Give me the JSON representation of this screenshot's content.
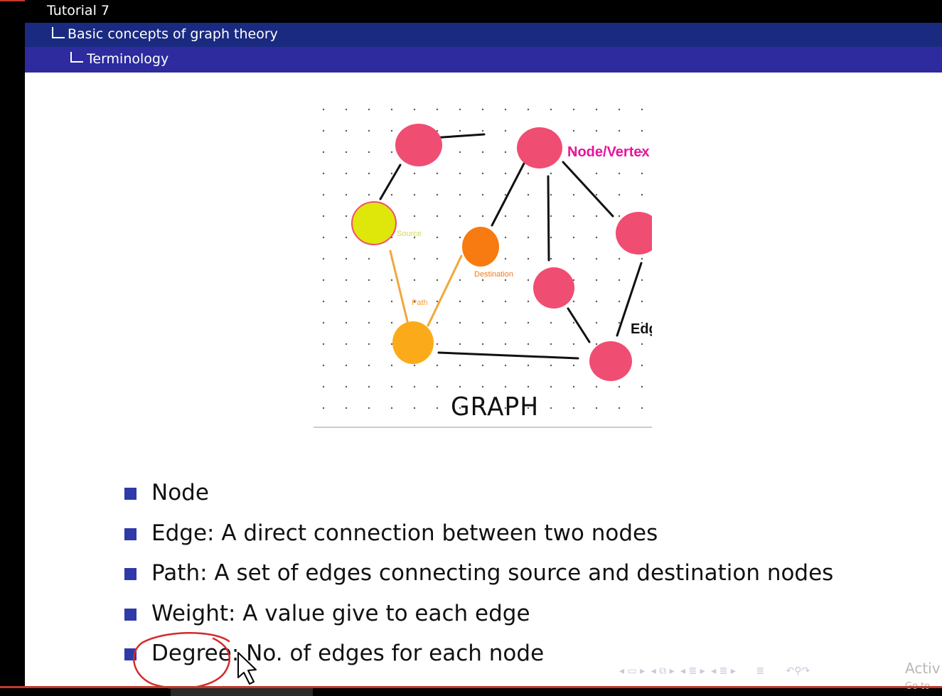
{
  "header": {
    "title": "Tutorial 7",
    "section": "Basic concepts of graph theory",
    "subsection": "Terminology"
  },
  "figure": {
    "labels": {
      "node_vertex": "Node/Vertex",
      "edge": "Edge",
      "source": "Source",
      "destination": "Destination",
      "path": "Path",
      "graph": "GRAPH"
    },
    "colors": {
      "node": "#f04d72",
      "source_node": "#dfe60a",
      "destination_node": "#f77b10",
      "path_node": "#fbab1a",
      "node_vertex_label": "#e8149a"
    }
  },
  "bullets": [
    {
      "text": "Node"
    },
    {
      "text": "Edge:  A direct connection between two nodes"
    },
    {
      "text": "Path:  A set of edges connecting source and destination nodes"
    },
    {
      "text": "Weight:  A value give to each edge"
    },
    {
      "text": "Degree:  No.  of edges for each node"
    }
  ],
  "navigation": {
    "icons": [
      "nav-frame-icon",
      "nav-subsection-icon",
      "nav-section-icon",
      "nav-document-icon",
      "nav-align-icon",
      "nav-search-icon"
    ]
  },
  "watermark": {
    "line1": "Activ",
    "line2": "Go to"
  },
  "annotation_color": "#d42a2a",
  "accent": "#2d2b9e"
}
